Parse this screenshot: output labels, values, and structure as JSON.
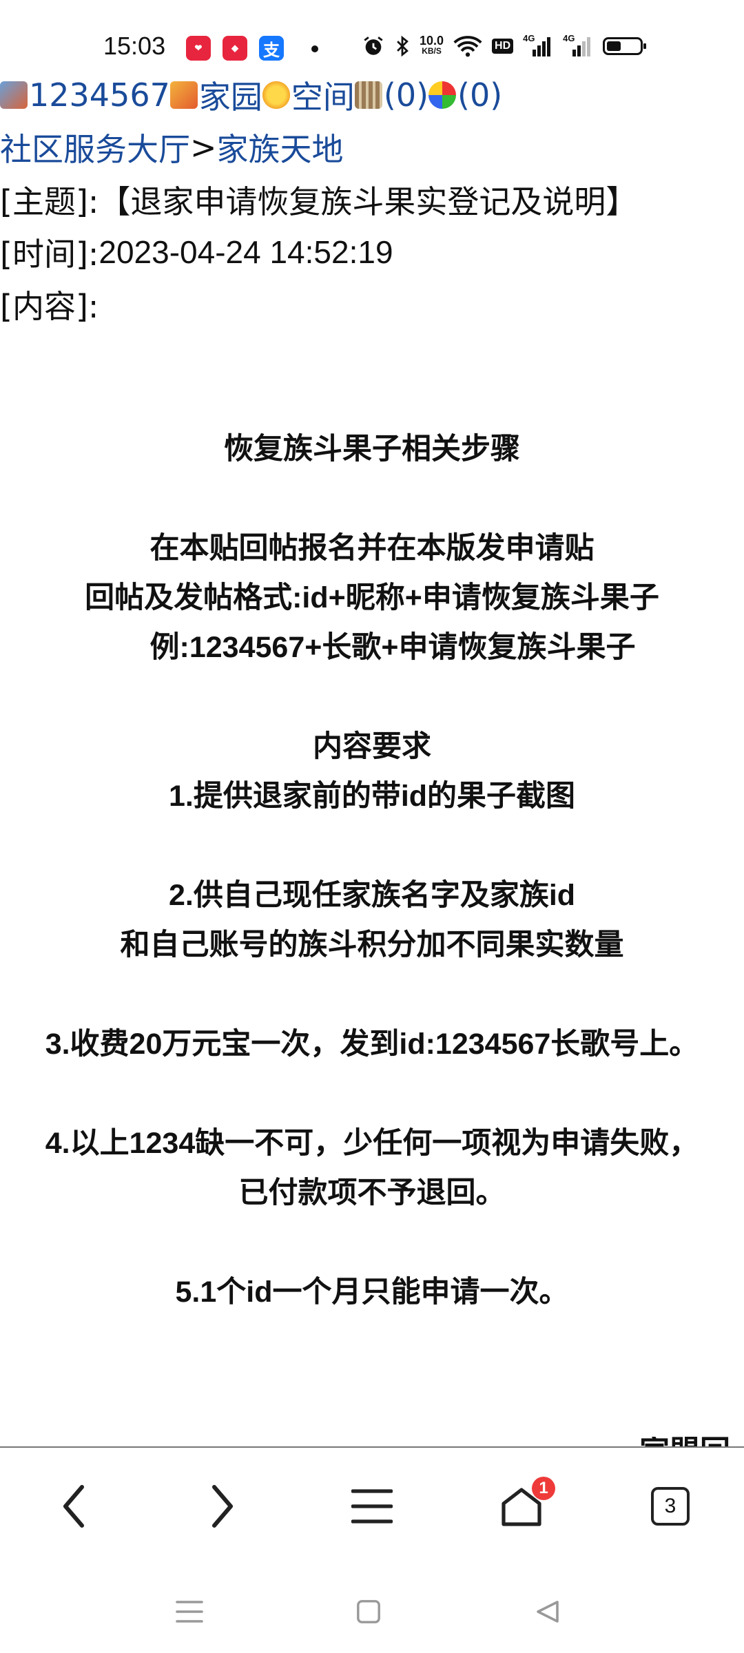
{
  "status_bar": {
    "time": "15:03",
    "net_speed_value": "10.0",
    "net_speed_unit": "KB/S",
    "hd": "HD",
    "signal_label_1": "4G",
    "signal_label_2": "4G"
  },
  "header": {
    "user_id": "1234567",
    "home_link": "家园",
    "space_link": "空间",
    "count_a": "(0)",
    "count_b": "(0)"
  },
  "breadcrumb": {
    "root": "社区服务大厅",
    "separator": ">",
    "section": "家族天地"
  },
  "post_meta": {
    "subject_label": "[主题]:",
    "subject": "【退家申请恢复族斗果实登记及说明】",
    "time_label": "[时间]:",
    "time": "2023-04-24 14:52:19",
    "content_label": "[内容]:"
  },
  "post_body": {
    "title": "恢复族斗果子相关步骤",
    "line1": "在本贴回帖报名并在本版发申请贴",
    "line2": "回帖及发帖格式:id+昵称+申请恢复族斗果子",
    "line3": "例:1234567+长歌+申请恢复族斗果子",
    "req_title": "内容要求",
    "req1": "1.提供退家前的带id的果子截图",
    "req2a": "2.供自己现任家族名字及家族id",
    "req2b": "和自己账号的族斗积分加不同果实数量",
    "req3": "3.收费20万元宝一次，发到id:1234567长歌号上。",
    "req4a": "4.以上1234缺一不可，少任何一项视为申请失败，",
    "req4b": "已付款项不予退回。",
    "req5": "5.1个id一个月只能申请一次。",
    "cut_text": "家盟回"
  },
  "toolbar": {
    "notification_count": "1",
    "tab_count": "3"
  }
}
